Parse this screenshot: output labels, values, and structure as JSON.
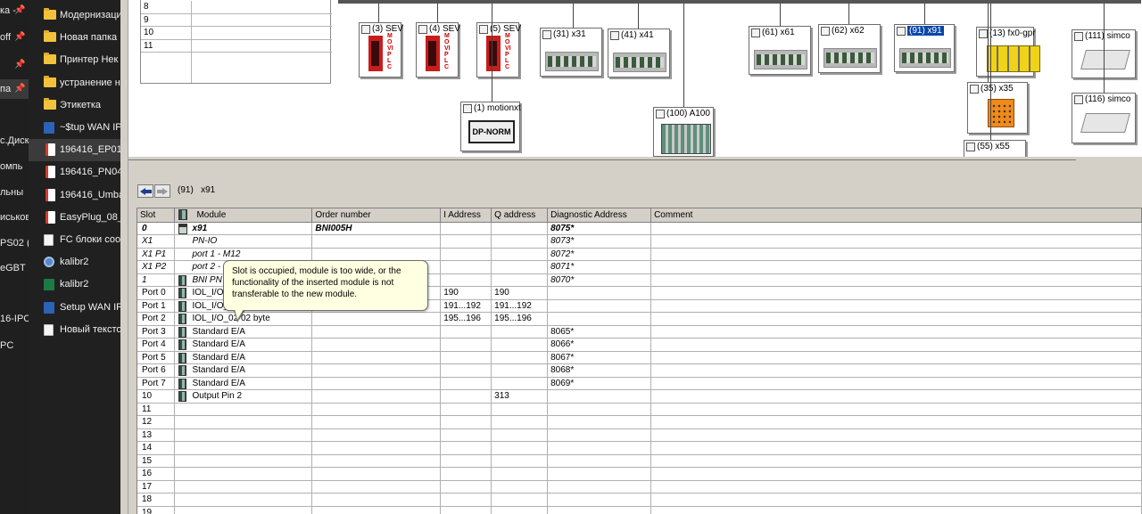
{
  "explorer_left": {
    "items": [
      {
        "label": "ка - ",
        "pinned": true
      },
      {
        "label": "off",
        "pinned": true
      },
      {
        "label": "",
        "pinned": true
      },
      {
        "label": "па",
        "pinned": true,
        "selected": true
      },
      {
        "label": "",
        "pinned": false
      },
      {
        "label": "с.Диск",
        "pinned": false
      },
      {
        "label": "омпь",
        "pinned": false
      },
      {
        "label": "льны",
        "pinned": false
      },
      {
        "label": "иськов",
        "pinned": false
      },
      {
        "label": "PS02 (",
        "pinned": false
      },
      {
        "label": "eGBT (",
        "pinned": false
      },
      {
        "label": "",
        "pinned": false
      },
      {
        "label": "16-IPC",
        "pinned": false
      },
      {
        "label": "PC",
        "pinned": false
      }
    ],
    "pin_glyph": "📌"
  },
  "explorer_files": {
    "items": [
      {
        "label": "Модернизаци",
        "icon": "folder"
      },
      {
        "label": "Новая папка",
        "icon": "folder"
      },
      {
        "label": "Принтер Нек",
        "icon": "folder"
      },
      {
        "label": "устранение н",
        "icon": "folder"
      },
      {
        "label": "Этикетка",
        "icon": "folder"
      },
      {
        "label": "~$tup WAN IP",
        "icon": "word"
      },
      {
        "label": "196416_EP01_",
        "icon": "pdf",
        "selected": true
      },
      {
        "label": "196416_PN04_",
        "icon": "pdf"
      },
      {
        "label": "196416_Umba",
        "icon": "pdf"
      },
      {
        "label": "EasyPlug_08_(",
        "icon": "pdf"
      },
      {
        "label": "FC блоки соо",
        "icon": "lnk"
      },
      {
        "label": "kalibr2",
        "icon": "gear"
      },
      {
        "label": "kalibr2",
        "icon": "xls"
      },
      {
        "label": "Setup WAN IP",
        "icon": "word"
      },
      {
        "label": "Новый текстов",
        "icon": "lnk"
      }
    ]
  },
  "mini_table": {
    "rows": [
      "8",
      "9",
      "10",
      "11"
    ]
  },
  "network": {
    "nodes": [
      {
        "label": "(3) SEV",
        "type": "sew",
        "side_text": "MOVIPLC"
      },
      {
        "label": "(4) SEV",
        "type": "sew",
        "side_text": "MOVIPLC"
      },
      {
        "label": "(5) SEV",
        "type": "sew",
        "side_text": "MOVIPLC"
      },
      {
        "label": "(31) x31",
        "type": "io"
      },
      {
        "label": "(41) x41",
        "type": "io"
      },
      {
        "label": "(1) motionxt",
        "type": "dp",
        "text": "DP-NORM"
      },
      {
        "label": "(100) A100",
        "type": "rack"
      },
      {
        "label": "(61) x61",
        "type": "io"
      },
      {
        "label": "(62) x62",
        "type": "io"
      },
      {
        "label": "(91) x91",
        "type": "io",
        "selected": true
      },
      {
        "label": "(13) fx0-gpr",
        "type": "yellow"
      },
      {
        "label": "(35) x35",
        "type": "orange"
      },
      {
        "label": "(55) x55",
        "type": "io"
      },
      {
        "label": "(111) simco",
        "type": "simco"
      },
      {
        "label": "(116) simco",
        "type": "simco"
      }
    ]
  },
  "detail": {
    "title": "(91)   x91",
    "back_icon": "back-arrow-icon",
    "forward_icon": "forward-arrow-icon"
  },
  "table": {
    "columns": [
      "Slot",
      "Module",
      "Order number",
      "I Address",
      "Q address",
      "Diagnostic Address",
      "Comment"
    ],
    "rows": [
      {
        "slot": "0",
        "module": "x91",
        "order": "BNI005H",
        "iaddr": "",
        "qaddr": "",
        "diag": "8075*",
        "style": "bold-italic",
        "icon": "head"
      },
      {
        "slot": "X1",
        "module": "PN-IO",
        "order": "",
        "iaddr": "",
        "qaddr": "",
        "diag": "8073*",
        "style": "italic",
        "icon": "none"
      },
      {
        "slot": "X1 P1",
        "module": "port 1 - M12",
        "order": "",
        "iaddr": "",
        "qaddr": "",
        "diag": "8072*",
        "style": "italic",
        "icon": "none"
      },
      {
        "slot": "X1 P2",
        "module": "port 2 - ",
        "order": "",
        "iaddr": "",
        "qaddr": "",
        "diag": "8071*",
        "style": "italic",
        "icon": "none"
      },
      {
        "slot": "1",
        "module": "BNI PN",
        "order": "",
        "iaddr": "",
        "qaddr": "",
        "diag": "8070*",
        "style": "italic",
        "icon": "module"
      },
      {
        "slot": "Port 0",
        "module": "IOL_I/O_",
        "order": "",
        "iaddr": "190",
        "qaddr": "190",
        "diag": "",
        "style": "normal",
        "icon": "module"
      },
      {
        "slot": "Port 1",
        "module": "IOL_I/O_",
        "order": "",
        "iaddr": "191...192",
        "qaddr": "191...192",
        "diag": "",
        "style": "normal",
        "icon": "module"
      },
      {
        "slot": "Port 2",
        "module": "IOL_I/O_02   02 byte",
        "order": "",
        "iaddr": "195...196",
        "qaddr": "195...196",
        "diag": "",
        "style": "normal",
        "icon": "module"
      },
      {
        "slot": "Port 3",
        "module": "Standard E/A",
        "order": "",
        "iaddr": "",
        "qaddr": "",
        "diag": "8065*",
        "style": "normal",
        "icon": "module"
      },
      {
        "slot": "Port 4",
        "module": "Standard E/A",
        "order": "",
        "iaddr": "",
        "qaddr": "",
        "diag": "8066*",
        "style": "normal",
        "icon": "module"
      },
      {
        "slot": "Port 5",
        "module": "Standard E/A",
        "order": "",
        "iaddr": "",
        "qaddr": "",
        "diag": "8067*",
        "style": "normal",
        "icon": "module"
      },
      {
        "slot": "Port 6",
        "module": "Standard E/A",
        "order": "",
        "iaddr": "",
        "qaddr": "",
        "diag": "8068*",
        "style": "normal",
        "icon": "module"
      },
      {
        "slot": "Port 7",
        "module": "Standard E/A",
        "order": "",
        "iaddr": "",
        "qaddr": "",
        "diag": "8069*",
        "style": "normal",
        "icon": "module"
      },
      {
        "slot": "10",
        "module": "Output Pin 2",
        "order": "",
        "iaddr": "",
        "qaddr": "313",
        "diag": "",
        "style": "normal",
        "icon": "module"
      },
      {
        "slot": "11",
        "module": "",
        "order": "",
        "iaddr": "",
        "qaddr": "",
        "diag": "",
        "style": "normal",
        "icon": "none"
      },
      {
        "slot": "12",
        "module": "",
        "order": "",
        "iaddr": "",
        "qaddr": "",
        "diag": "",
        "style": "normal",
        "icon": "none"
      },
      {
        "slot": "13",
        "module": "",
        "order": "",
        "iaddr": "",
        "qaddr": "",
        "diag": "",
        "style": "normal",
        "icon": "none"
      },
      {
        "slot": "14",
        "module": "",
        "order": "",
        "iaddr": "",
        "qaddr": "",
        "diag": "",
        "style": "normal",
        "icon": "none"
      },
      {
        "slot": "15",
        "module": "",
        "order": "",
        "iaddr": "",
        "qaddr": "",
        "diag": "",
        "style": "normal",
        "icon": "none"
      },
      {
        "slot": "16",
        "module": "",
        "order": "",
        "iaddr": "",
        "qaddr": "",
        "diag": "",
        "style": "normal",
        "icon": "none"
      },
      {
        "slot": "17",
        "module": "",
        "order": "",
        "iaddr": "",
        "qaddr": "",
        "diag": "",
        "style": "normal",
        "icon": "none"
      },
      {
        "slot": "18",
        "module": "",
        "order": "",
        "iaddr": "",
        "qaddr": "",
        "diag": "",
        "style": "normal",
        "icon": "none"
      },
      {
        "slot": "19",
        "module": "",
        "order": "",
        "iaddr": "",
        "qaddr": "",
        "diag": "",
        "style": "normal",
        "icon": "none"
      }
    ]
  },
  "tooltip": {
    "text": "Slot is occupied, module is too wide, or the functionality of the inserted module is not transferable to the new module."
  }
}
